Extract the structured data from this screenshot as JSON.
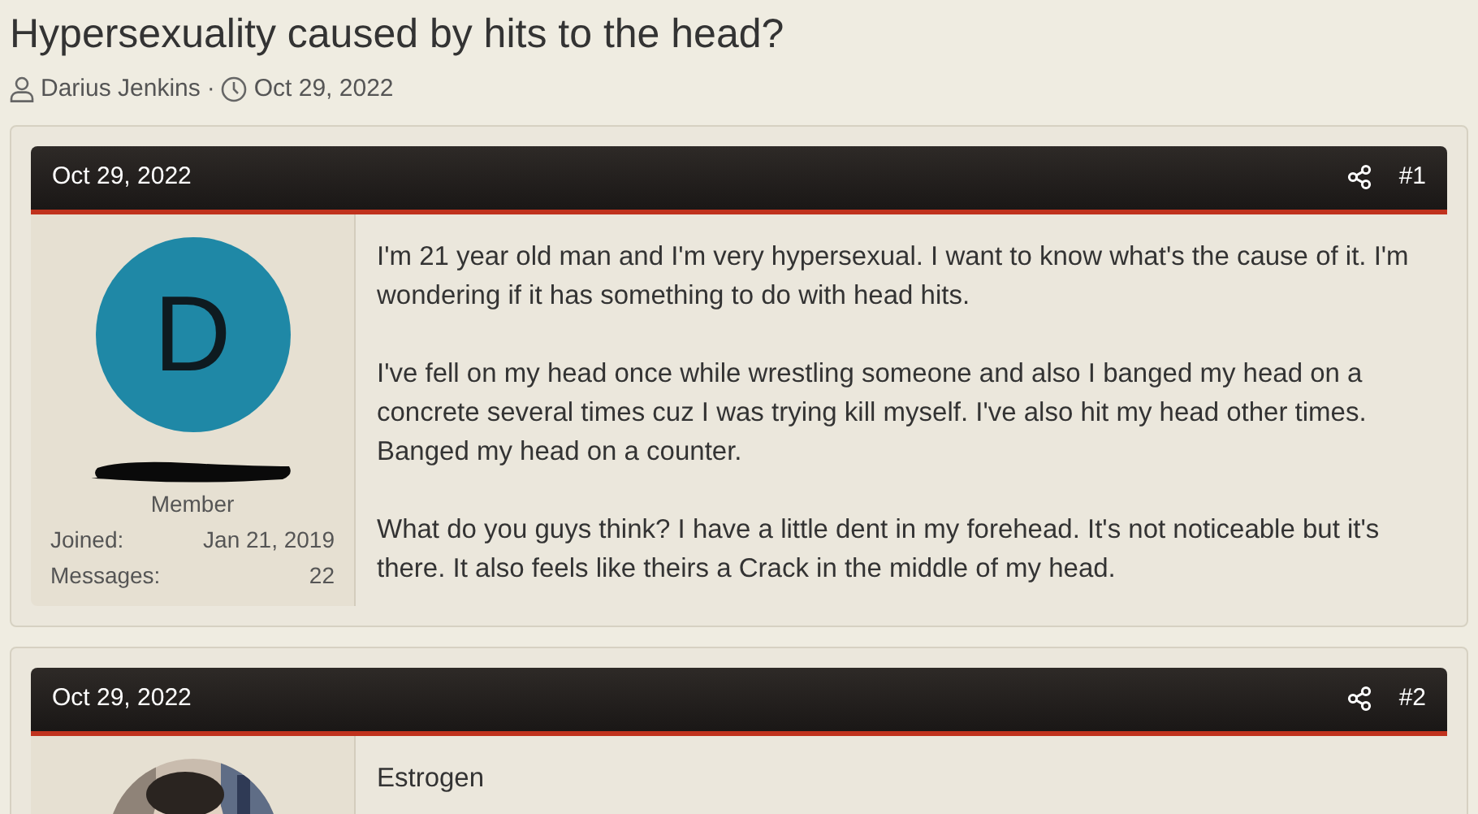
{
  "thread": {
    "title": "Hypersexuality caused by hits to the head?",
    "author": "Darius Jenkins",
    "separator": "·",
    "date": "Oct 29, 2022"
  },
  "posts": [
    {
      "date": "Oct 29, 2022",
      "number": "#1",
      "avatar": {
        "kind": "letter",
        "letter": "D",
        "color": "#1f88a6"
      },
      "role": "Member",
      "stats": [
        {
          "label": "Joined:",
          "value": "Jan 21, 2019"
        },
        {
          "label": "Messages:",
          "value": "22"
        }
      ],
      "paragraphs": [
        "I'm 21 year old man and I'm very hypersexual. I want to know what's the cause of it. I'm wondering if it has something to do with head hits.",
        "I've fell on my head once while wrestling someone and also I banged my head on a concrete several times cuz I was trying kill myself. I've also hit my head other times. Banged my head on a counter.",
        "What do you guys think? I have a little dent in my forehead. It's not noticeable but it's there. It also feels like theirs a Crack in the middle of my head."
      ]
    },
    {
      "date": "Oct 29, 2022",
      "number": "#2",
      "avatar": {
        "kind": "picture"
      },
      "paragraphs": [
        "Estrogen"
      ]
    }
  ]
}
